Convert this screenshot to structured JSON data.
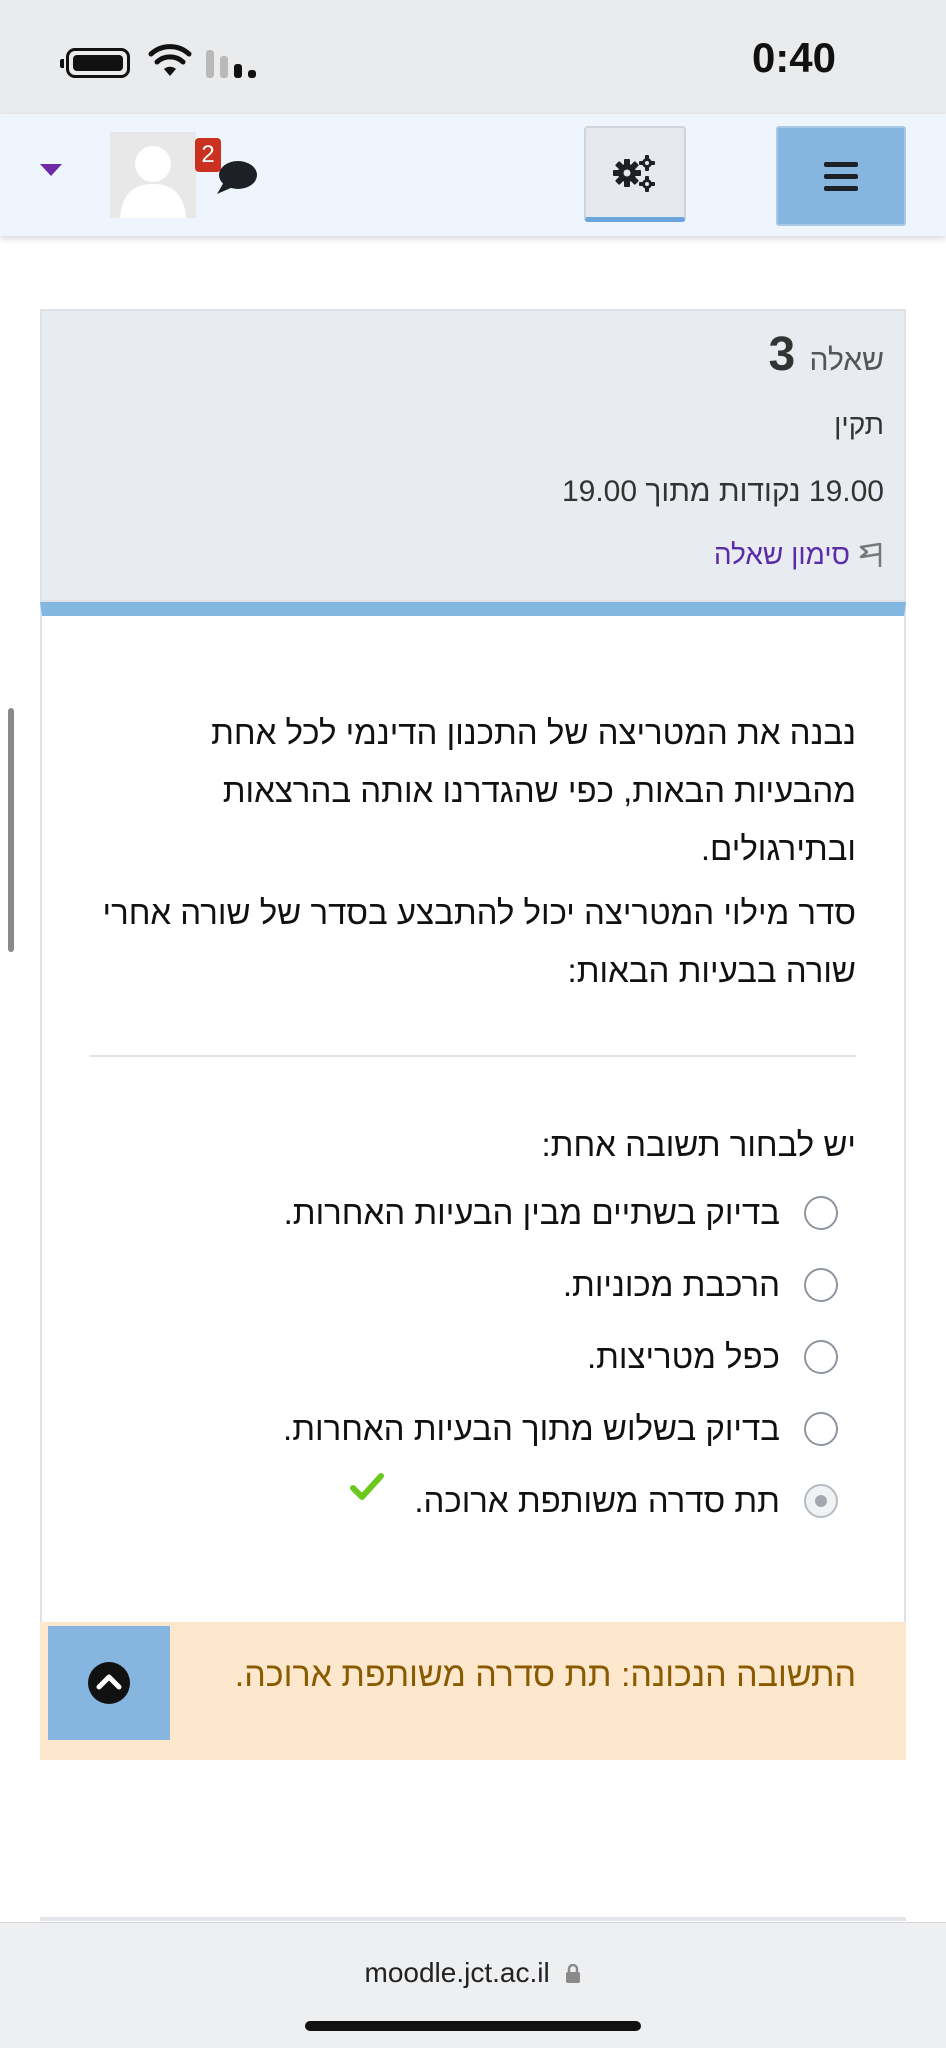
{
  "status_bar": {
    "time": "0:40"
  },
  "navbar": {
    "messages_count": "2"
  },
  "question_info": {
    "label": "שאלה",
    "number": "3",
    "state": "תקין",
    "grade": "19.00 נקודות מתוך 19.00",
    "flag_label": "סימון שאלה"
  },
  "question": {
    "paragraph1": "נבנה את המטריצה של התכנון הדינמי לכל אחת מהבעיות הבאות, כפי שהגדרנו אותה בהרצאות ובתירגולים.",
    "paragraph2": "סדר מילוי המטריצה יכול להתבצע בסדר של שורה אחרי שורה בבעיות הבאות:",
    "prompt": "יש לבחור תשובה אחת:",
    "options": [
      {
        "label": "בדיוק בשתיים מבין הבעיות האחרות.",
        "selected": false
      },
      {
        "label": "הרכבת מכוניות.",
        "selected": false
      },
      {
        "label": "כפל מטריצות.",
        "selected": false
      },
      {
        "label": "בדיוק בשלוש מתוך הבעיות האחרות.",
        "selected": false
      },
      {
        "label": "תת סדרה משותפת ארוכה.",
        "selected": true,
        "correct": true
      }
    ]
  },
  "feedback": {
    "right_answer": "התשובה הנכונה: תת סדרה משותפת ארוכה."
  },
  "browser": {
    "url": "moodle.jct.ac.il"
  },
  "colors": {
    "accent_blue": "#86b6e0",
    "flag_purple": "#5a2ca8",
    "correct_green": "#6cc71f",
    "feedback_bg": "#fde8cd",
    "badge_red": "#ca3120"
  }
}
